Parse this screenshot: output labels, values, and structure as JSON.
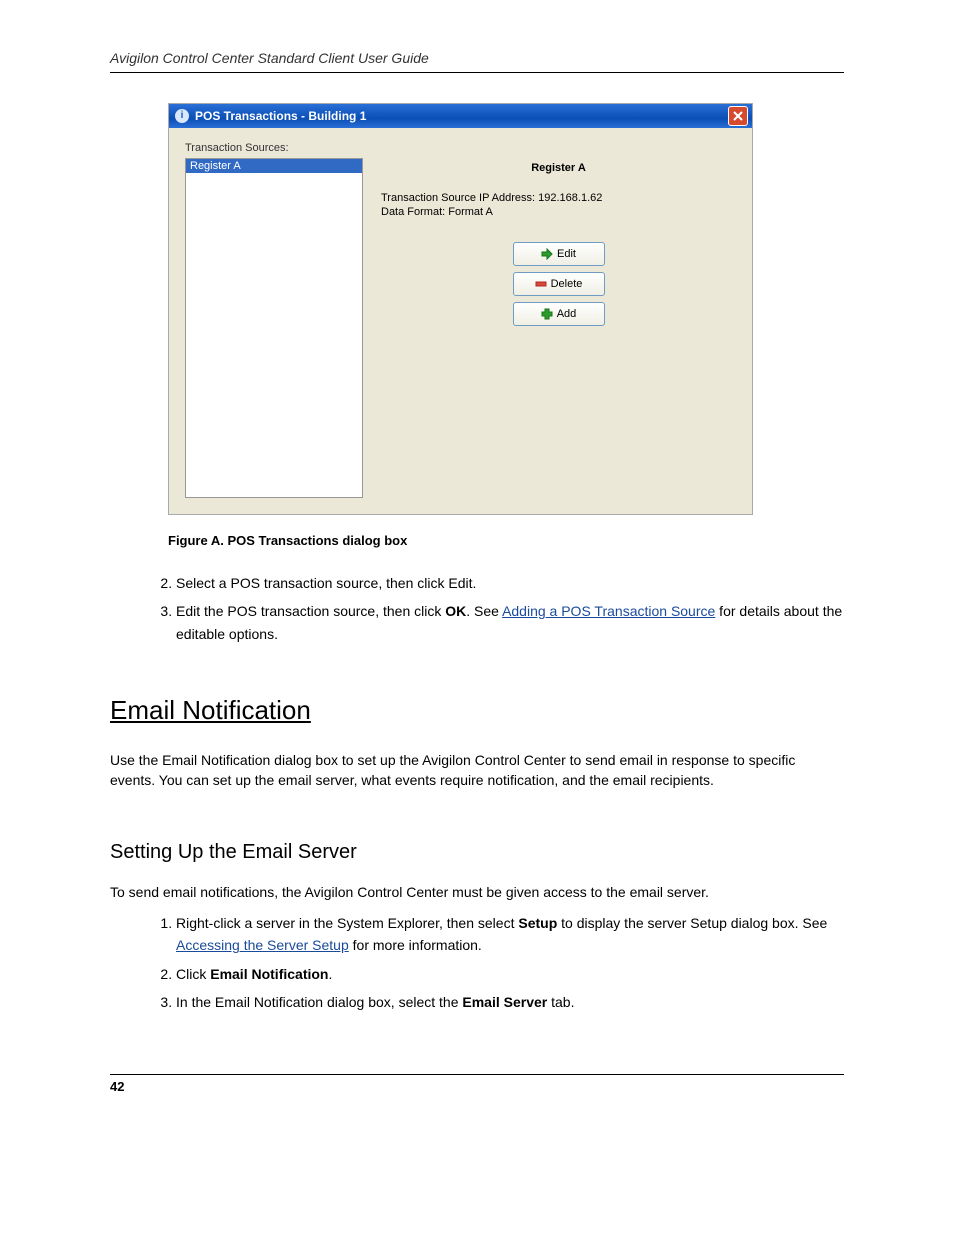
{
  "header": "Avigilon Control Center Standard Client User Guide",
  "dialog": {
    "title": "POS Transactions - Building 1",
    "sources_label": "Transaction Sources:",
    "sources": [
      "Register A"
    ],
    "detail_heading": "Register A",
    "ip_line": "Transaction Source IP Address: 192.168.1.62",
    "format_line": "Data Format: Format A",
    "buttons": {
      "edit": "Edit",
      "delete": "Delete",
      "add": "Add"
    }
  },
  "figure_caption": "Figure A. POS Transactions dialog box",
  "step2": "Select a POS transaction source, then click Edit.",
  "step3_pre": "Edit the POS transaction source, then click ",
  "step3_ok": "OK",
  "step3_post": ". See ",
  "step3_link": "Adding a POS Transaction Source",
  "step3_after": " for details about the editable options.",
  "section_h2": "Email Notification",
  "email_para": "Use the Email Notification dialog box to set up the Avigilon Control Center to send email in response to specific events. You can set up the email server, what events require notification, and the email recipients.",
  "section_h3": "Setting Up the Email Server",
  "email_server_para": "To send email notifications, the Avigilon Control Center must be given access to the email server.",
  "ol2_step1_pre": "Right-click a server in the System Explorer, then select ",
  "ol2_step1_bold": "Setup",
  "ol2_step1_post": " to display the server Setup dialog box. See ",
  "ol2_step1_link": "Accessing the Server Setup",
  "ol2_step1_after": " for more information.",
  "ol2_step2_pre": "Click ",
  "ol2_step2_bold": "Email Notification",
  "ol2_step2_post": ".",
  "ol2_step3_pre": "In the Email Notification dialog box, select the ",
  "ol2_step3_bold": "Email Server ",
  "ol2_step3_post": "tab.",
  "page_number": "42"
}
